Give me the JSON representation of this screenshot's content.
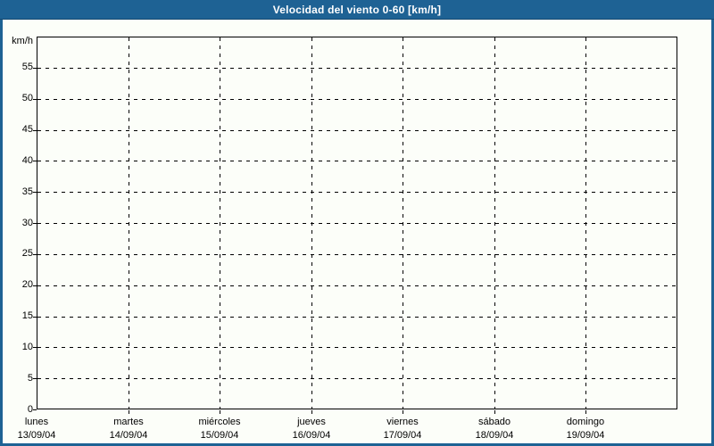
{
  "title_bar": {
    "title": "Velocidad del viento 0-60 [km/h]",
    "bg_color": "#1e6294",
    "text_color": "#ffffff"
  },
  "chart_data": {
    "type": "line",
    "title": "Velocidad del viento 0-60 [km/h]",
    "xlabel": "",
    "ylabel": "km/h",
    "ylim": [
      0,
      60
    ],
    "y_tick_step": 5,
    "y_ticks": [
      0,
      5,
      10,
      15,
      20,
      25,
      30,
      35,
      40,
      45,
      50,
      55
    ],
    "x_categories": [
      {
        "day": "lunes",
        "date": "13/09/04"
      },
      {
        "day": "martes",
        "date": "14/09/04"
      },
      {
        "day": "miércoles",
        "date": "15/09/04"
      },
      {
        "day": "jueves",
        "date": "16/09/04"
      },
      {
        "day": "viernes",
        "date": "17/09/04"
      },
      {
        "day": "sábado",
        "date": "18/09/04"
      },
      {
        "day": "domingo",
        "date": "19/09/04"
      }
    ],
    "series": [],
    "grid": "dashed",
    "legend": "none"
  },
  "colors": {
    "accent_blue": "#1e6294",
    "grid_line": "#000000",
    "background": "#fcfef9"
  }
}
